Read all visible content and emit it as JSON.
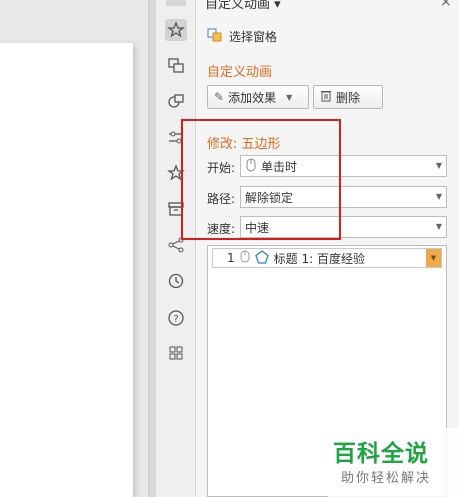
{
  "panel": {
    "title": "自定义动画 ▾",
    "select_pane_label": "选择窗格",
    "section_title": "自定义动画",
    "add_effect_label": "添加效果",
    "delete_label": "删除"
  },
  "modify": {
    "title": "修改: 五边形",
    "start_label": "开始:",
    "start_value": "单击时",
    "path_label": "路径:",
    "path_value": "解除锁定",
    "speed_label": "速度:",
    "speed_value": "中速"
  },
  "list": {
    "items": [
      {
        "index": "1",
        "text": "标题 1: 百度经验"
      }
    ]
  },
  "watermark": {
    "main": "百科全说",
    "sub": "助你轻松解决"
  },
  "icons": [
    "star-icon",
    "animation-icon",
    "shapes-icon",
    "sliders-icon",
    "favorite-icon",
    "box-icon",
    "share-icon",
    "history-icon",
    "help-icon",
    "apps-icon"
  ],
  "colors": {
    "section_orange": "#d96b1f",
    "highlight_red": "#e01b1b",
    "watermark_green": "#1ea345"
  }
}
